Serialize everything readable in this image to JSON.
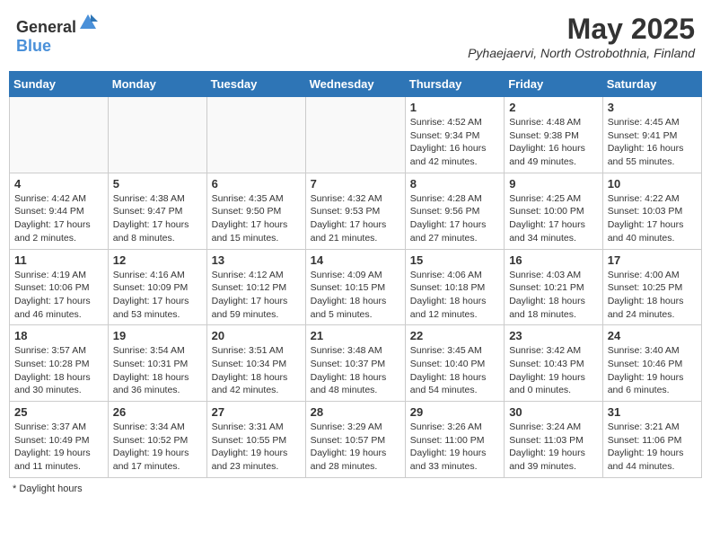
{
  "header": {
    "logo_general": "General",
    "logo_blue": "Blue",
    "month_title": "May 2025",
    "location": "Pyhaejaervi, North Ostrobothnia, Finland"
  },
  "days_of_week": [
    "Sunday",
    "Monday",
    "Tuesday",
    "Wednesday",
    "Thursday",
    "Friday",
    "Saturday"
  ],
  "weeks": [
    [
      {
        "day": "",
        "info": ""
      },
      {
        "day": "",
        "info": ""
      },
      {
        "day": "",
        "info": ""
      },
      {
        "day": "",
        "info": ""
      },
      {
        "day": "1",
        "info": "Sunrise: 4:52 AM\nSunset: 9:34 PM\nDaylight: 16 hours and 42 minutes."
      },
      {
        "day": "2",
        "info": "Sunrise: 4:48 AM\nSunset: 9:38 PM\nDaylight: 16 hours and 49 minutes."
      },
      {
        "day": "3",
        "info": "Sunrise: 4:45 AM\nSunset: 9:41 PM\nDaylight: 16 hours and 55 minutes."
      }
    ],
    [
      {
        "day": "4",
        "info": "Sunrise: 4:42 AM\nSunset: 9:44 PM\nDaylight: 17 hours and 2 minutes."
      },
      {
        "day": "5",
        "info": "Sunrise: 4:38 AM\nSunset: 9:47 PM\nDaylight: 17 hours and 8 minutes."
      },
      {
        "day": "6",
        "info": "Sunrise: 4:35 AM\nSunset: 9:50 PM\nDaylight: 17 hours and 15 minutes."
      },
      {
        "day": "7",
        "info": "Sunrise: 4:32 AM\nSunset: 9:53 PM\nDaylight: 17 hours and 21 minutes."
      },
      {
        "day": "8",
        "info": "Sunrise: 4:28 AM\nSunset: 9:56 PM\nDaylight: 17 hours and 27 minutes."
      },
      {
        "day": "9",
        "info": "Sunrise: 4:25 AM\nSunset: 10:00 PM\nDaylight: 17 hours and 34 minutes."
      },
      {
        "day": "10",
        "info": "Sunrise: 4:22 AM\nSunset: 10:03 PM\nDaylight: 17 hours and 40 minutes."
      }
    ],
    [
      {
        "day": "11",
        "info": "Sunrise: 4:19 AM\nSunset: 10:06 PM\nDaylight: 17 hours and 46 minutes."
      },
      {
        "day": "12",
        "info": "Sunrise: 4:16 AM\nSunset: 10:09 PM\nDaylight: 17 hours and 53 minutes."
      },
      {
        "day": "13",
        "info": "Sunrise: 4:12 AM\nSunset: 10:12 PM\nDaylight: 17 hours and 59 minutes."
      },
      {
        "day": "14",
        "info": "Sunrise: 4:09 AM\nSunset: 10:15 PM\nDaylight: 18 hours and 5 minutes."
      },
      {
        "day": "15",
        "info": "Sunrise: 4:06 AM\nSunset: 10:18 PM\nDaylight: 18 hours and 12 minutes."
      },
      {
        "day": "16",
        "info": "Sunrise: 4:03 AM\nSunset: 10:21 PM\nDaylight: 18 hours and 18 minutes."
      },
      {
        "day": "17",
        "info": "Sunrise: 4:00 AM\nSunset: 10:25 PM\nDaylight: 18 hours and 24 minutes."
      }
    ],
    [
      {
        "day": "18",
        "info": "Sunrise: 3:57 AM\nSunset: 10:28 PM\nDaylight: 18 hours and 30 minutes."
      },
      {
        "day": "19",
        "info": "Sunrise: 3:54 AM\nSunset: 10:31 PM\nDaylight: 18 hours and 36 minutes."
      },
      {
        "day": "20",
        "info": "Sunrise: 3:51 AM\nSunset: 10:34 PM\nDaylight: 18 hours and 42 minutes."
      },
      {
        "day": "21",
        "info": "Sunrise: 3:48 AM\nSunset: 10:37 PM\nDaylight: 18 hours and 48 minutes."
      },
      {
        "day": "22",
        "info": "Sunrise: 3:45 AM\nSunset: 10:40 PM\nDaylight: 18 hours and 54 minutes."
      },
      {
        "day": "23",
        "info": "Sunrise: 3:42 AM\nSunset: 10:43 PM\nDaylight: 19 hours and 0 minutes."
      },
      {
        "day": "24",
        "info": "Sunrise: 3:40 AM\nSunset: 10:46 PM\nDaylight: 19 hours and 6 minutes."
      }
    ],
    [
      {
        "day": "25",
        "info": "Sunrise: 3:37 AM\nSunset: 10:49 PM\nDaylight: 19 hours and 11 minutes."
      },
      {
        "day": "26",
        "info": "Sunrise: 3:34 AM\nSunset: 10:52 PM\nDaylight: 19 hours and 17 minutes."
      },
      {
        "day": "27",
        "info": "Sunrise: 3:31 AM\nSunset: 10:55 PM\nDaylight: 19 hours and 23 minutes."
      },
      {
        "day": "28",
        "info": "Sunrise: 3:29 AM\nSunset: 10:57 PM\nDaylight: 19 hours and 28 minutes."
      },
      {
        "day": "29",
        "info": "Sunrise: 3:26 AM\nSunset: 11:00 PM\nDaylight: 19 hours and 33 minutes."
      },
      {
        "day": "30",
        "info": "Sunrise: 3:24 AM\nSunset: 11:03 PM\nDaylight: 19 hours and 39 minutes."
      },
      {
        "day": "31",
        "info": "Sunrise: 3:21 AM\nSunset: 11:06 PM\nDaylight: 19 hours and 44 minutes."
      }
    ]
  ],
  "footer": {
    "note": "Daylight hours"
  }
}
